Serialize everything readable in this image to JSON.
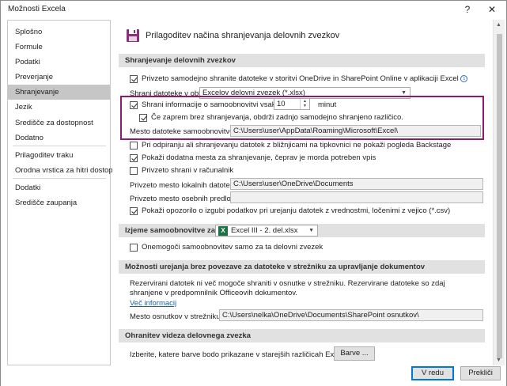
{
  "window": {
    "title": "Možnosti Excela",
    "help_glyph": "?",
    "close_glyph": "✕"
  },
  "sidebar": {
    "items": [
      {
        "label": "Splošno"
      },
      {
        "label": "Formule"
      },
      {
        "label": "Podatki"
      },
      {
        "label": "Preverjanje"
      },
      {
        "label": "Shranjevanje",
        "selected": true
      },
      {
        "label": "Jezik"
      },
      {
        "label": "Središče za dostopnost"
      },
      {
        "label": "Dodatno"
      },
      {
        "label": "Prilagoditev traku"
      },
      {
        "label": "Orodna vrstica za hitri dostop"
      },
      {
        "label": "Dodatki"
      },
      {
        "label": "Središče zaupanja"
      }
    ]
  },
  "main": {
    "header_title": "Prilagoditev načina shranjevanja delovnih zvezkov",
    "section1": {
      "title": "Shranjevanje delovnih zvezkov",
      "autosave_onedrive": "Privzeto samodejno shranite datoteke v storitvi OneDrive in SharePoint Online v aplikaciji Excel",
      "save_format_label": "Shrani datoteke v obliki:",
      "save_format_value": "Excelov delovni zvezek (*.xlsx)",
      "autorecover_label": "Shrani informacije o samoobnovitvi vsakih",
      "autorecover_minutes": "10",
      "minutes_label": "minut",
      "keep_last_label": "Če zaprem brez shranjevanja, obdrži zadnjo samodejno shranjeno različico.",
      "autorecover_location_label": "Mesto datoteke samoobnovitve:",
      "autorecover_location_value": "C:\\Users\\user\\AppData\\Roaming\\Microsoft\\Excel\\",
      "no_backstage_label": "Pri odpiranju ali shranjevanju datotek z bližnjicami na tipkovnici ne pokaži pogleda Backstage",
      "show_extra_places_label": "Pokaži dodatna mesta za shranjevanje, čeprav je morda potreben vpis",
      "save_to_computer_label": "Privzeto shrani v računalnik",
      "default_local_label": "Privzeto mesto lokalnih datotek:",
      "default_local_value": "C:\\Users\\user\\OneDrive\\Documents",
      "default_personal_label": "Privzeto mesto osebnih predlog:",
      "default_personal_value": "",
      "csv_warning_label": "Pokaži opozorilo o izgubi podatkov pri urejanju datotek z vrednostmi, ločenimi z vejico (*.csv)"
    },
    "section2": {
      "exceptions_label": "Izjeme samoobnovitve za:",
      "exceptions_value": "Excel III - 2. del.xlsx",
      "disable_autorecover_label": "Onemogoči samoobnovitev samo za ta delovni zvezek"
    },
    "section3": {
      "title": "Možnosti urejanja brez povezave za datoteke v strežniku za upravljanje dokumentov",
      "para": "Rezervirani datotek ni več mogoče shraniti v osnutke v strežniku. Rezervirane datoteke so zdaj shranjene v predpomnilnik Officeovih dokumentov.",
      "more_info": "Več informacij",
      "drafts_label": "Mesto osnutkov v strežniku:",
      "drafts_value": "C:\\Users\\nelka\\OneDrive\\Documents\\SharePoint osnutkov\\"
    },
    "section4": {
      "title": "Ohranitev videza delovnega zvezka",
      "colors_label": "Izberite, katere barve bodo prikazane v starejših različicah Excela:",
      "colors_button": "Barve ..."
    }
  },
  "footer": {
    "ok": "V redu",
    "cancel": "Prekliči"
  },
  "colors": {
    "highlight_border": "#8e1a6b",
    "section_bg": "#e1e1e1",
    "selected_nav": "#c6c6c6",
    "ok_border": "#0078d7"
  }
}
